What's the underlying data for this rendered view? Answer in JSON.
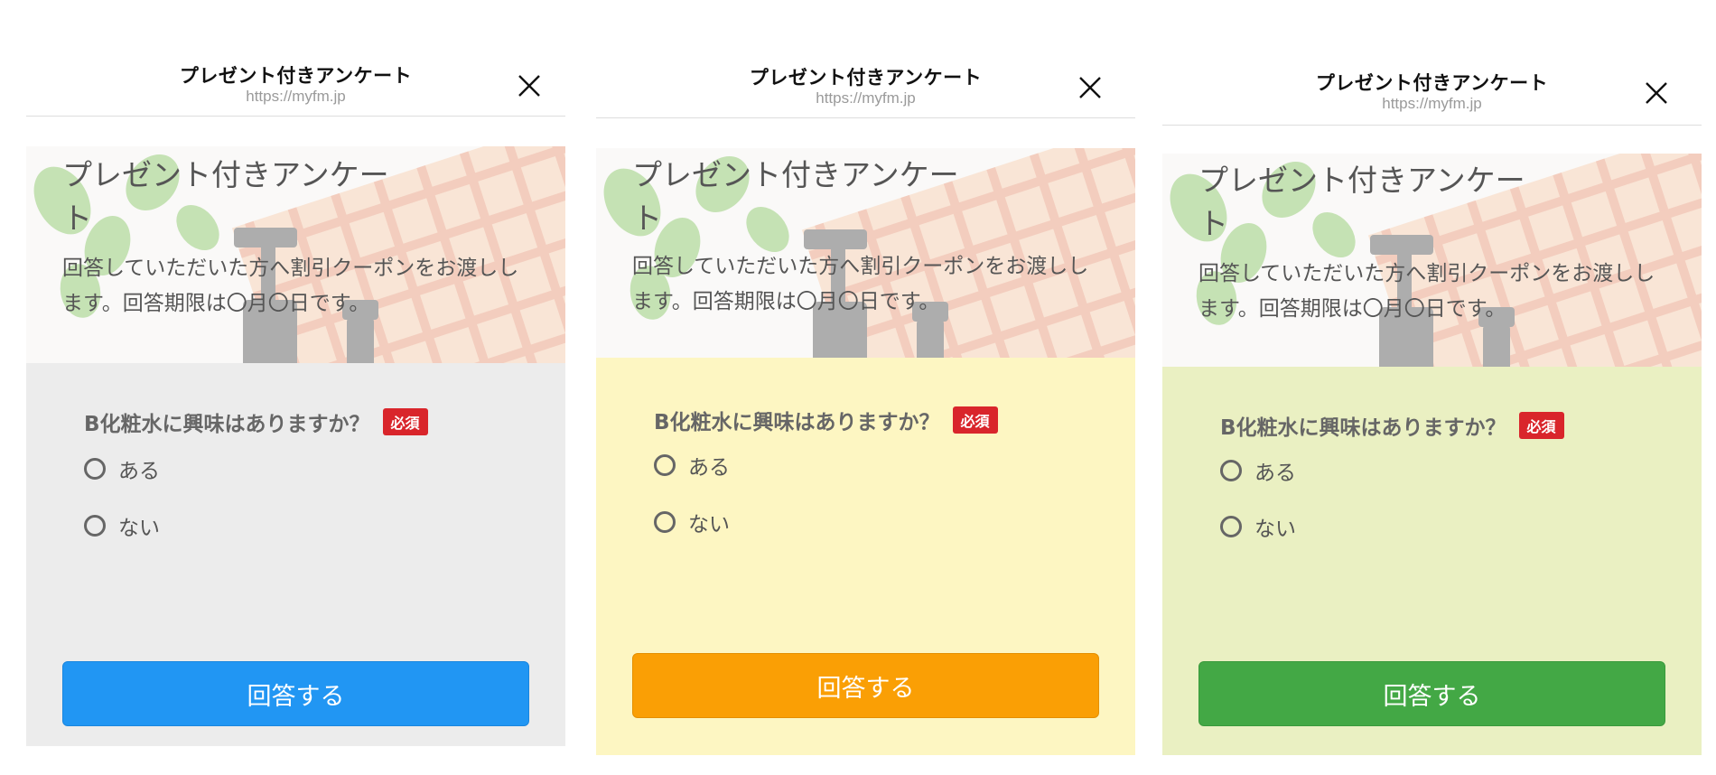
{
  "header": {
    "title": "プレゼント付きアンケート",
    "url": "https://myfm.jp"
  },
  "hero": {
    "title": "プレゼント付きアンケー ト",
    "description": "回答していただいた方へ割引クーポンをお渡しします。回答期限は〇月〇日です。"
  },
  "question": {
    "text": "B化粧水に興味はありますか？",
    "required_badge": "必須",
    "options": [
      "ある",
      "ない"
    ]
  },
  "submit_label": "回答する",
  "variants": [
    {
      "theme": "gray",
      "body_bg": "#ececec",
      "button_color": "#2196f3"
    },
    {
      "theme": "yellow",
      "body_bg": "#fdf6c2",
      "button_color": "#fa9f05"
    },
    {
      "theme": "green",
      "body_bg": "#eaf0c2",
      "button_color": "#43a845"
    }
  ],
  "colors": {
    "required_badge": "#d9252b",
    "icon_close": "close-icon",
    "icon_radio": "radio-icon"
  }
}
